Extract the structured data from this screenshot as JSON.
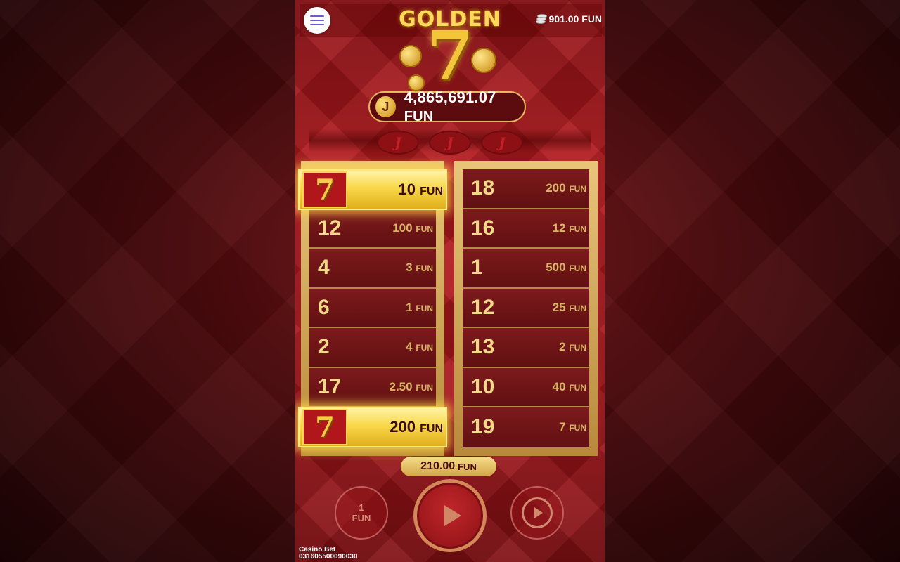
{
  "header": {
    "balance": "901.00 FUN",
    "logo_title": "GOLDEN",
    "logo_number": "7"
  },
  "jackpot": {
    "icon_letter": "J",
    "value": "4,865,691.07",
    "unit": "FUN"
  },
  "left_column": {
    "winning_top": {
      "symbol": "7",
      "prize": "10",
      "unit": "FUN"
    },
    "rows": [
      {
        "number": "12",
        "prize": "100",
        "unit": "FUN"
      },
      {
        "number": "4",
        "prize": "3",
        "unit": "FUN"
      },
      {
        "number": "6",
        "prize": "1",
        "unit": "FUN"
      },
      {
        "number": "2",
        "prize": "4",
        "unit": "FUN"
      },
      {
        "number": "17",
        "prize": "2.50",
        "unit": "FUN"
      }
    ],
    "winning_bottom": {
      "symbol": "7",
      "prize": "200",
      "unit": "FUN"
    }
  },
  "right_column": {
    "rows": [
      {
        "number": "18",
        "prize": "200",
        "unit": "FUN"
      },
      {
        "number": "16",
        "prize": "12",
        "unit": "FUN"
      },
      {
        "number": "1",
        "prize": "500",
        "unit": "FUN"
      },
      {
        "number": "12",
        "prize": "25",
        "unit": "FUN"
      },
      {
        "number": "13",
        "prize": "2",
        "unit": "FUN"
      },
      {
        "number": "10",
        "prize": "40",
        "unit": "FUN"
      },
      {
        "number": "19",
        "prize": "7",
        "unit": "FUN"
      }
    ]
  },
  "total_win": {
    "value": "210.00",
    "unit": "FUN"
  },
  "controls": {
    "bet_value": "1",
    "bet_unit": "FUN",
    "play_icon": "play-icon",
    "autoplay_icon": "autoplay-icon"
  },
  "footer": {
    "brand": "Casino Bet",
    "ticket_id": "031605500090030"
  },
  "colors": {
    "primary_red": "#b3191d",
    "gold": "#e9c57a",
    "highlight": "#f8d84a"
  }
}
